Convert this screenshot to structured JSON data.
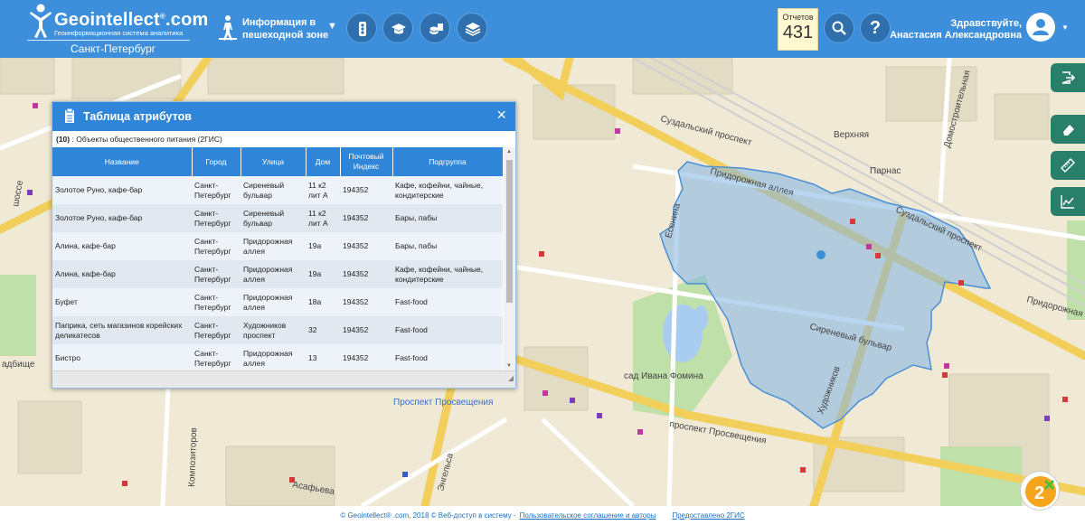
{
  "header": {
    "brand": "Geointellect",
    "brand_dot": ".com",
    "brand_reg": "®",
    "tagline": "Геоинформационная система аналитика",
    "city": "Санкт-Петербург",
    "pedestrian_label_line1": "Информация в",
    "pedestrian_label_line2": "пешеходной зоне",
    "pedestrian_caret": "▼",
    "tools": [
      "traffic-light-icon",
      "graduation-cap-icon",
      "coins-icon",
      "layers-icon"
    ],
    "reports_label": "Отчетов",
    "reports_count": "431",
    "search_icon": "search-icon",
    "help_label": "?",
    "greeting_line1": "Здравствуйте,",
    "greeting_line2": "Анастасия Александровна",
    "user_caret": "▼"
  },
  "map": {
    "streets": [
      "Суздальский проспект",
      "Придорожная аллея",
      "Сиреневый бульвар",
      "Художников",
      "проспект Просвещения",
      "Есенина",
      "Композиторов",
      "Асафьева",
      "Энгельса",
      "Верхняя",
      "Домостроительная",
      "Придорожная",
      "Суздальский проспект",
      "Придорожная аллея"
    ],
    "places": [
      "сад Ивана Фомина",
      "Парнас",
      "Проспект Просвещения",
      "шоссе",
      "адбище"
    ],
    "zone_color": "#7fb4e6"
  },
  "attr_panel": {
    "title": "Таблица атрибутов",
    "close": "×",
    "count": "(10)",
    "layer": ": Объекты общественного питания (2ГИС)",
    "columns": [
      "Название",
      "Город",
      "Улица",
      "Дом",
      "Почтовый Индекс",
      "Подгруппа"
    ],
    "rows": [
      [
        "Золотое Руно, кафе-бар",
        "Санкт-Петербург",
        "Сиреневый бульвар",
        "11 к2 лит А",
        "194352",
        "Кафе, кофейни, чайные, кондитерские"
      ],
      [
        "Золотое Руно, кафе-бар",
        "Санкт-Петербург",
        "Сиреневый бульвар",
        "11 к2 лит А",
        "194352",
        "Бары, пабы"
      ],
      [
        "Алина, кафе-бар",
        "Санкт-Петербург",
        "Придорожная аллея",
        "19а",
        "194352",
        "Бары, пабы"
      ],
      [
        "Алина, кафе-бар",
        "Санкт-Петербург",
        "Придорожная аллея",
        "19а",
        "194352",
        "Кафе, кофейни, чайные, кондитерские"
      ],
      [
        "Буфет",
        "Санкт-Петербург",
        "Придорожная аллея",
        "18а",
        "194352",
        "Fast-food"
      ],
      [
        "Паприка, сеть магазинов корейских деликатесов",
        "Санкт-Петербург",
        "Художников проспект",
        "32",
        "194352",
        "Fast-food"
      ],
      [
        "Бистро",
        "Санкт-Петербург",
        "Придорожная аллея",
        "13",
        "194352",
        "Fast-food"
      ]
    ]
  },
  "right_tools": [
    "exit-icon",
    "eraser-icon",
    "ruler-icon",
    "chart-icon"
  ],
  "footer": {
    "copyright": "© Geointellect® .com, 2018 © Веб-доступ в систему -",
    "terms": "Пользовательское соглашение и авторы",
    "provided": "Предоставлено 2ГИС"
  }
}
